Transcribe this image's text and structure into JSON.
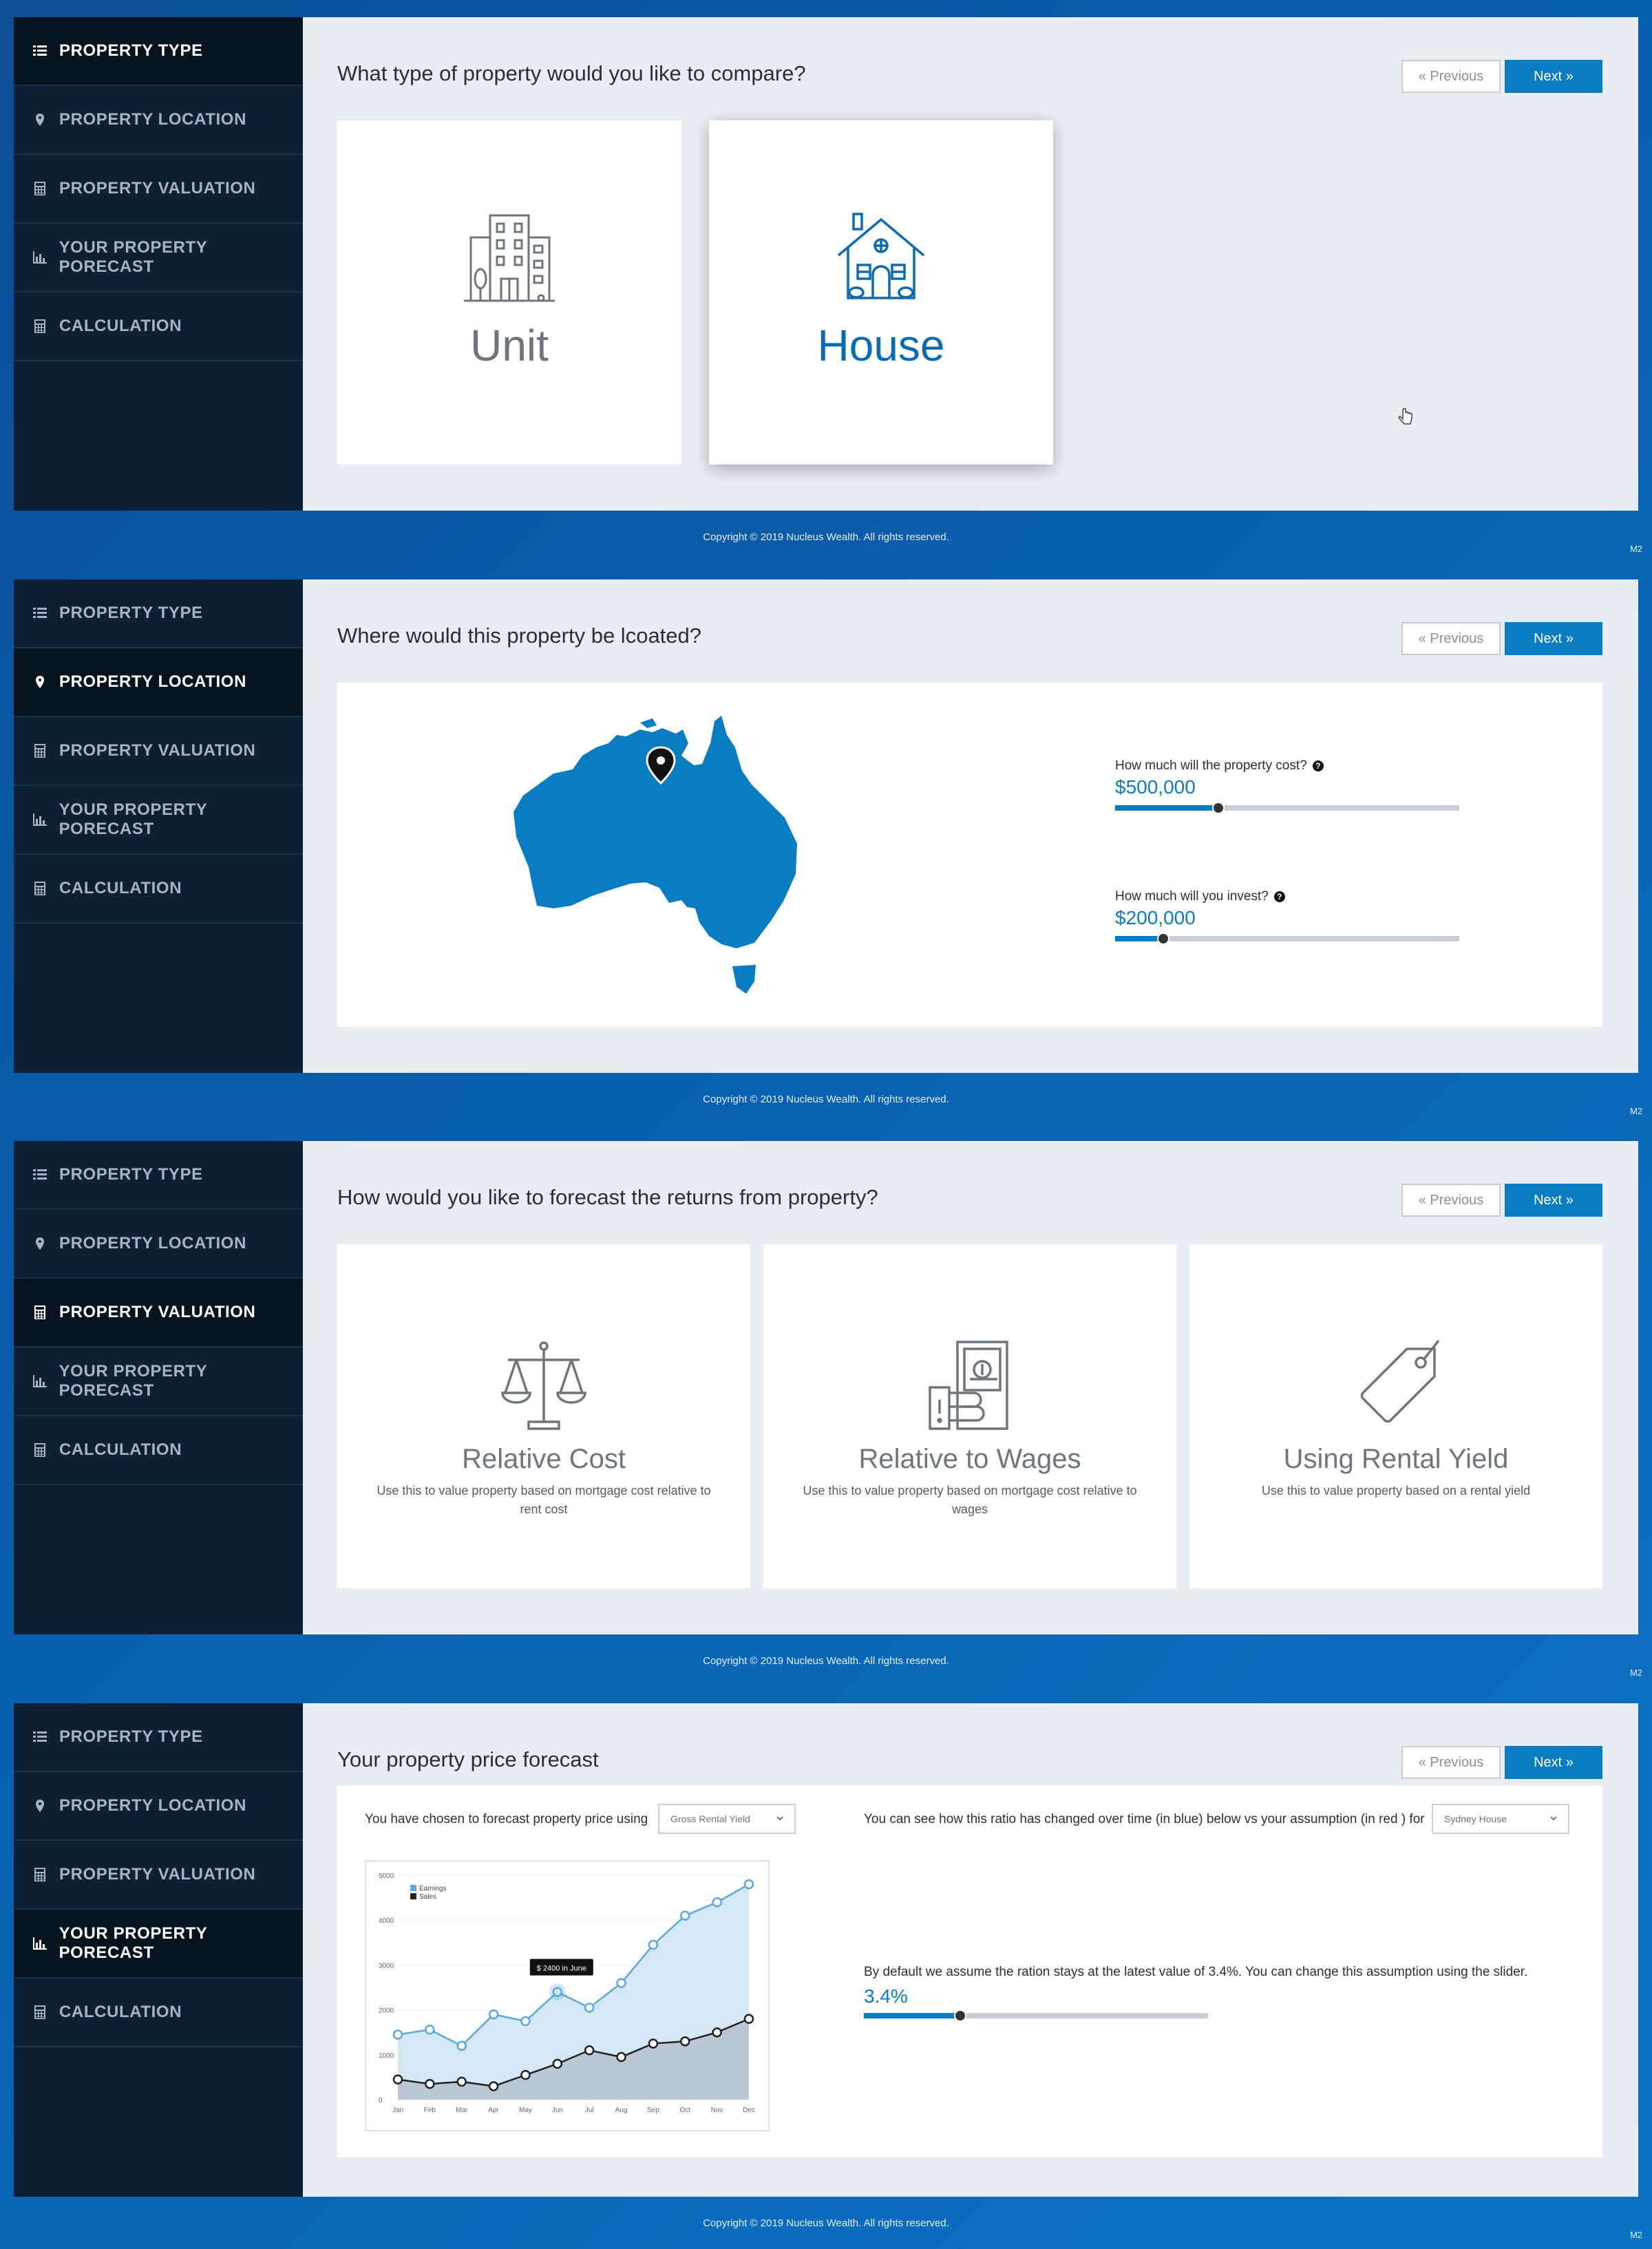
{
  "sidebar_items": [
    {
      "label": "PROPERTY TYPE",
      "icon": "list-icon"
    },
    {
      "label": "PROPERTY LOCATION",
      "icon": "map-pin-icon"
    },
    {
      "label": "PROPERTY VALUATION",
      "icon": "calculator-icon"
    },
    {
      "label": "YOUR PROPERTY PORECAST",
      "icon": "bar-chart-icon"
    },
    {
      "label": "CALCULATION",
      "icon": "calculator-icon"
    }
  ],
  "buttons": {
    "previous": "« Previous",
    "next": "Next »"
  },
  "footer": {
    "copyright": "Copyright © 2019 Nucleus Wealth. All rights reserved.",
    "corner_tag": "M2"
  },
  "colors": {
    "accent": "#0a7cc1",
    "sidebar": "#0d2035",
    "sidebar_active": "#07131f",
    "background": "#e9ecf1"
  },
  "screen1": {
    "question": "What type of property would you like to compare?",
    "active_step": 0,
    "cards": [
      {
        "label": "Unit",
        "icon": "apartment-building-icon",
        "selected": false
      },
      {
        "label": "House",
        "icon": "house-icon",
        "selected": true
      }
    ]
  },
  "screen2": {
    "question": "Where would this property be lcoated?",
    "active_step": 1,
    "cost_slider": {
      "label": "How much will the property cost?",
      "value": "$500,000",
      "fill": 0.3
    },
    "invest_slider": {
      "label": "How much will you invest?",
      "value": "$200,000",
      "fill": 0.14
    }
  },
  "screen3": {
    "question": "How would you like to forecast the returns from property?",
    "active_step": 2,
    "options": [
      {
        "title": "Relative Cost",
        "description": "Use this to value property based on mortgage cost relative to rent cost",
        "icon": "scales-icon"
      },
      {
        "title": "Relative to Wages",
        "description": "Use this to value property based on mortgage cost relative to wages",
        "icon": "hand-money-icon"
      },
      {
        "title": "Using Rental Yield",
        "description": "Use this to value property based on a rental yield",
        "icon": "price-tag-icon"
      }
    ]
  },
  "screen4": {
    "title": "Your property price forecast",
    "active_step": 3,
    "chosen_text": "You have chosen to forecast property price using",
    "method_select": "Gross Rental Yield",
    "ratio_text": "You can see how this ratio has changed over time (in blue) below vs your assumption (in red ) for",
    "property_select": "Sydney House",
    "default_text": "By default we assume the ration stays at the latest value of 3.4%. You can change this assumption using the slider.",
    "ratio_value": "3.4%",
    "ratio_fill": 0.28
  },
  "chart_data": {
    "type": "area",
    "categories": [
      "Jan",
      "Feb",
      "Mar",
      "Apr",
      "May",
      "Jun",
      "Jul",
      "Aug",
      "Sep",
      "Oct",
      "Nov",
      "Dec"
    ],
    "yticks": [
      "0",
      "1000",
      "2000",
      "3000",
      "4000",
      "5000"
    ],
    "ylim": [
      0,
      5000
    ],
    "series": [
      {
        "name": "Earnings",
        "color": "#5aa8dc",
        "values": [
          1450,
          1560,
          1200,
          1900,
          1750,
          2400,
          2050,
          2600,
          3450,
          4100,
          4400,
          4800
        ]
      },
      {
        "name": "Sales",
        "color": "#222222",
        "values": [
          450,
          350,
          400,
          300,
          550,
          800,
          1100,
          950,
          1250,
          1300,
          1500,
          1800
        ]
      }
    ],
    "tooltip": "$ 2400 in June",
    "grid": true,
    "legend_position": "top-left"
  }
}
